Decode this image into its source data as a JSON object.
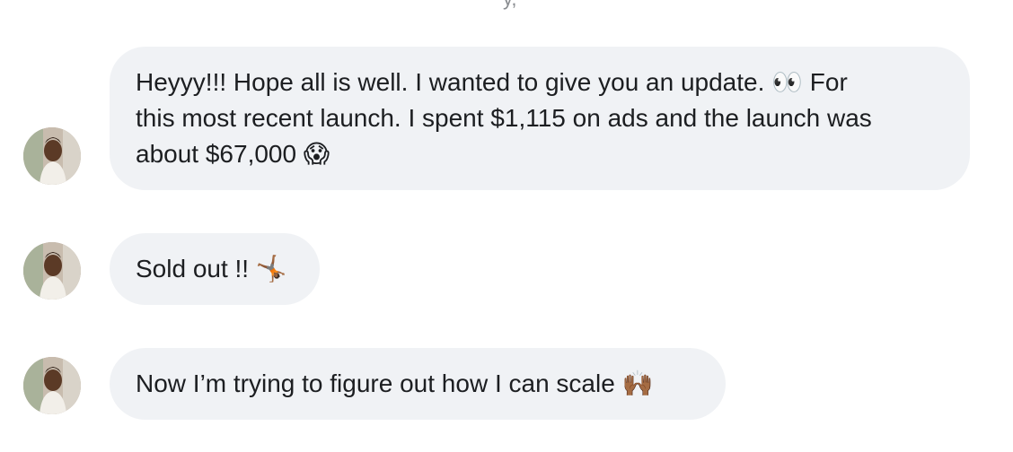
{
  "conversation": {
    "top_fragment": "y,",
    "messages": [
      {
        "lines": [
          "Heyyy!!! Hope all is well. I wanted to give you an update. 👀 For",
          "this most recent launch. I spent $1,115 on ads and the launch was",
          "about $67,000 😱"
        ]
      },
      {
        "lines": [
          "Sold out !! 🤸🏾"
        ]
      },
      {
        "lines": [
          "Now I’m trying to figure out how I can scale 🙌🏾"
        ]
      }
    ]
  },
  "colors": {
    "bubble_background": "#f0f2f5",
    "text": "#1c1e21",
    "page_background": "#ffffff"
  },
  "icons": {
    "avatar": "user-avatar-photo"
  }
}
